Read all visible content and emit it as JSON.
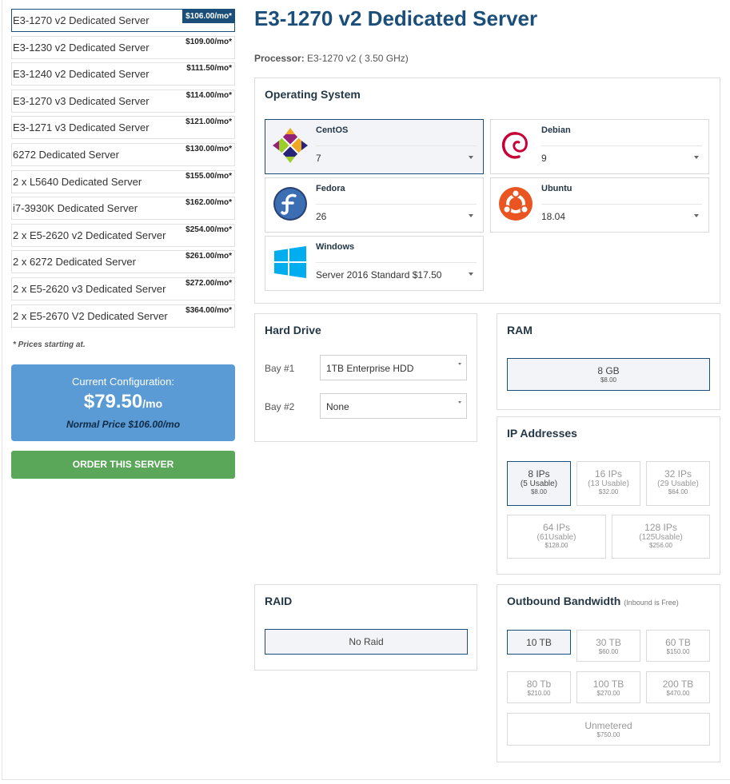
{
  "servers": [
    {
      "name": "E3-1270 v2 Dedicated Server",
      "price": "$106.00/mo*",
      "active": true
    },
    {
      "name": "E3-1230 v2 Dedicated Server",
      "price": "$109.00/mo*"
    },
    {
      "name": "E3-1240 v2 Dedicated Server",
      "price": "$111.50/mo*"
    },
    {
      "name": "E3-1270 v3 Dedicated Server",
      "price": "$114.00/mo*"
    },
    {
      "name": "E3-1271 v3 Dedicated Server",
      "price": "$121.00/mo*"
    },
    {
      "name": "6272 Dedicated Server",
      "price": "$130.00/mo*"
    },
    {
      "name": "2 x L5640 Dedicated Server",
      "price": "$155.00/mo*"
    },
    {
      "name": "i7-3930K Dedicated Server",
      "price": "$162.00/mo*"
    },
    {
      "name": "2 x E5-2620 v2 Dedicated Server",
      "price": "$254.00/mo*"
    },
    {
      "name": "2 x 6272 Dedicated Server",
      "price": "$261.00/mo*"
    },
    {
      "name": "2 x E5-2620 v3 Dedicated Server",
      "price": "$272.00/mo*"
    },
    {
      "name": "2 x E5-2670 V2 Dedicated Server",
      "price": "$364.00/mo*"
    }
  ],
  "price_note": "* Prices starting at.",
  "config": {
    "label": "Current Configuration:",
    "price": "$79.50",
    "price_suffix": "/mo",
    "normal_price": "Normal Price $106.00/mo"
  },
  "order_button": "ORDER THIS SERVER",
  "title": "E3-1270 v2 Dedicated Server",
  "processor": {
    "label": "Processor:",
    "value": "E3-1270 v2 ( 3.50 GHz)"
  },
  "os": {
    "title": "Operating System",
    "options": [
      {
        "name": "CentOS",
        "version": "7",
        "icon": "centos-icon",
        "selected": true
      },
      {
        "name": "Debian",
        "version": "9",
        "icon": "debian-icon"
      },
      {
        "name": "Fedora",
        "version": "26",
        "icon": "fedora-icon"
      },
      {
        "name": "Ubuntu",
        "version": "18.04",
        "icon": "ubuntu-icon"
      },
      {
        "name": "Windows",
        "version": "Server 2016 Standard $17.50",
        "icon": "windows-icon"
      }
    ]
  },
  "hard_drive": {
    "title": "Hard Drive",
    "bays": [
      {
        "label": "Bay #1",
        "value": "1TB Enterprise HDD"
      },
      {
        "label": "Bay #2",
        "value": "None"
      }
    ]
  },
  "ram": {
    "title": "RAM",
    "options": [
      {
        "label": "8 GB",
        "price": "$8.00",
        "selected": true
      }
    ]
  },
  "ip": {
    "title": "IP Addresses",
    "options": [
      {
        "label": "8 IPs",
        "sub": "(5 Usable)",
        "price": "$8.00",
        "selected": true
      },
      {
        "label": "16 IPs",
        "sub": "(13 Usable)",
        "price": "$32.00"
      },
      {
        "label": "32 IPs",
        "sub": "(29 Usable)",
        "price": "$64.00"
      },
      {
        "label": "64 IPs",
        "sub": "(61Usable)",
        "price": "$128.00"
      },
      {
        "label": "128 IPs",
        "sub": "(125Usable)",
        "price": "$256.00"
      }
    ]
  },
  "raid": {
    "title": "RAID",
    "options": [
      {
        "label": "No Raid",
        "selected": true
      }
    ]
  },
  "bandwidth": {
    "title": "Outbound Bandwidth",
    "subtitle": "(Inbound is Free)",
    "options": [
      {
        "label": "10 TB",
        "price": "",
        "selected": true
      },
      {
        "label": "30 TB",
        "price": "$60.00"
      },
      {
        "label": "60 TB",
        "price": "$150.00"
      },
      {
        "label": "80 Tb",
        "price": "$210.00"
      },
      {
        "label": "100 TB",
        "price": "$270.00"
      },
      {
        "label": "200 TB",
        "price": "$470.00"
      },
      {
        "label": "Unmetered",
        "price": "$750.00"
      }
    ]
  },
  "colors": {
    "brand": "#1b4f7a",
    "config_bg": "#5b9bd5",
    "order_bg": "#5aa75a"
  }
}
